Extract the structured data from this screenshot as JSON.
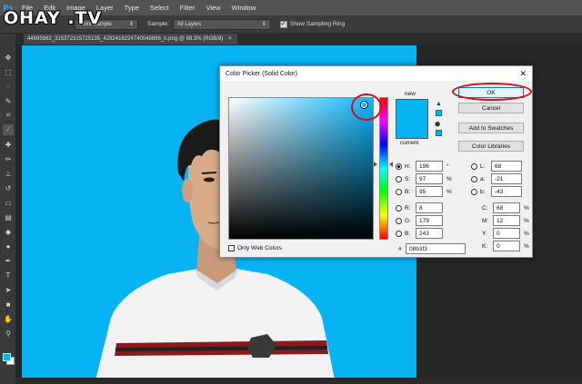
{
  "watermark": "OHAY .TV",
  "menubar": {
    "logo": "Ps",
    "items": [
      "File",
      "Edit",
      "Image",
      "Layer",
      "Type",
      "Select",
      "Filter",
      "View",
      "Window"
    ]
  },
  "options": {
    "sample_size_value": "Point Sample",
    "sample_label": "Sample:",
    "sample_value": "All Layers",
    "show_ring_label": "Show Sampling Ring",
    "show_ring_checked": true
  },
  "document": {
    "tab_title": "44695982_315372315725135_4282416224740048896_n.png @ 68.3% (RGB/8)",
    "close_symbol": "×"
  },
  "dialog": {
    "title": "Color Picker (Solid Color)",
    "close_symbol": "✕",
    "new_label": "new",
    "current_label": "current",
    "ok_label": "OK",
    "cancel_label": "Cancel",
    "add_to_swatches_label": "Add to Swatches",
    "color_libraries_label": "Color Libraries",
    "only_web_colors_label": "Only Web Colors",
    "hsb": [
      {
        "label": "H:",
        "value": "196",
        "unit": "°",
        "selected": true
      },
      {
        "label": "S:",
        "value": "97",
        "unit": "%",
        "selected": false
      },
      {
        "label": "B:",
        "value": "95",
        "unit": "%",
        "selected": false
      }
    ],
    "rgb": [
      {
        "label": "R:",
        "value": "8"
      },
      {
        "label": "G:",
        "value": "179"
      },
      {
        "label": "B:",
        "value": "243"
      }
    ],
    "lab": [
      {
        "label": "L:",
        "value": "68"
      },
      {
        "label": "a:",
        "value": "-21"
      },
      {
        "label": "b:",
        "value": "-43"
      }
    ],
    "cmyk": [
      {
        "label": "C:",
        "value": "68",
        "unit": "%"
      },
      {
        "label": "M:",
        "value": "12",
        "unit": "%"
      },
      {
        "label": "Y:",
        "value": "0",
        "unit": "%"
      },
      {
        "label": "K:",
        "value": "0",
        "unit": "%"
      }
    ],
    "hex_label": "#",
    "hex_value": "08b3f3"
  },
  "colors": {
    "selected": "#08b3f3",
    "annotation": "#d0101a"
  }
}
